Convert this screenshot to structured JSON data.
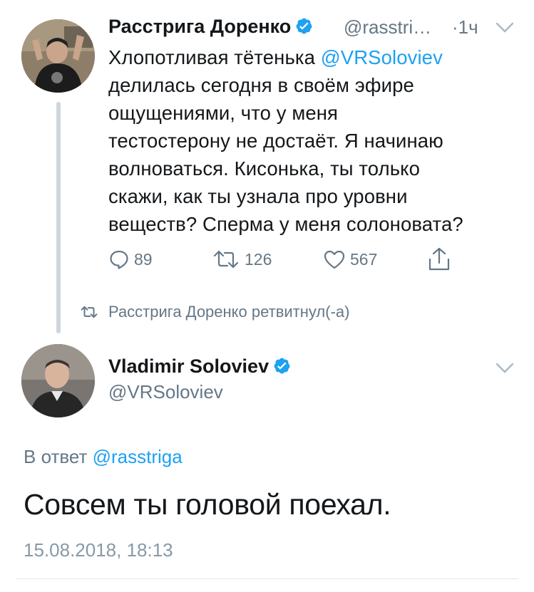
{
  "colors": {
    "link": "#1da1f2",
    "muted": "#657786",
    "text": "#14171a",
    "verified": "#1da1f2"
  },
  "retweet": {
    "author_name": "Расстрига Доренко",
    "author_handle": "@rasstri…",
    "time_sep": "·",
    "time": "1ч",
    "text_lines": [
      {
        "pre": "Хлопотливая тётенька ",
        "mention": "@VRSoloviev"
      },
      {
        "pre": "делилась сегодня в своём эфире",
        "mention": ""
      },
      {
        "pre": "ощущениями, что у меня",
        "mention": ""
      },
      {
        "pre": "тестостерону не достаёт. Я начинаю",
        "mention": ""
      },
      {
        "pre": "волноваться. Кисонька, ты только",
        "mention": ""
      },
      {
        "pre": "скажи, как ты узнала про уровни",
        "mention": ""
      },
      {
        "pre": "веществ? Сперма у меня солоновата?",
        "mention": ""
      }
    ],
    "actions": {
      "reply_count": "89",
      "retweet_count": "126",
      "like_count": "567"
    },
    "retweet_notice": "Расстрига Доренко ретвитнул(-а)"
  },
  "tweet": {
    "author_name": "Vladimir Soloviev",
    "author_handle": "@VRSoloviev",
    "reply_prefix": "В ответ ",
    "reply_mention": "@rasstriga",
    "text": "Совсем ты головой поехал.",
    "timestamp": "15.08.2018, 18:13"
  },
  "icons": {
    "verified": "verified-badge-icon",
    "caret": "chevron-down-icon",
    "reply": "reply-bubble-icon",
    "retweet": "retweet-icon",
    "like": "heart-icon",
    "share": "share-icon"
  }
}
